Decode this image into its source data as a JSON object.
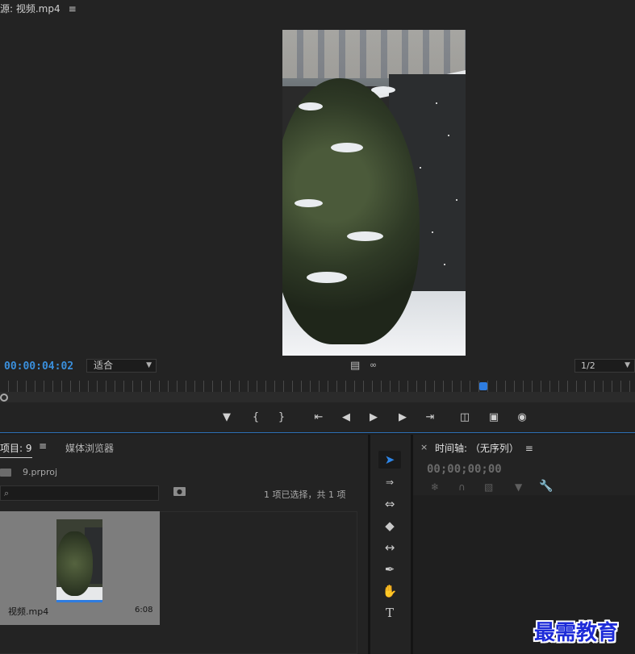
{
  "source_monitor": {
    "tab_label": "源: 视频.mp4",
    "menu_glyph": "≡",
    "timecode": "00:00:04:02",
    "fit_label": "适合",
    "resolution_label": "1/2",
    "accent_color": "#2e7ce0"
  },
  "project_panel": {
    "tab_label": "项目: 9",
    "menu_glyph": "≡",
    "media_browser_tab": "媒体浏览器",
    "project_file": "9.prproj",
    "search_icon_glyph": "⌕",
    "selection_info": "1 项已选择，共 1 项",
    "clip": {
      "name": "视频.mp4",
      "duration": "6:08"
    }
  },
  "timeline_panel": {
    "close_glyph": "×",
    "title": "时间轴: （无序列）",
    "menu_glyph": "≡",
    "timecode": "00;00;00;00"
  },
  "watermark": "最需教育"
}
